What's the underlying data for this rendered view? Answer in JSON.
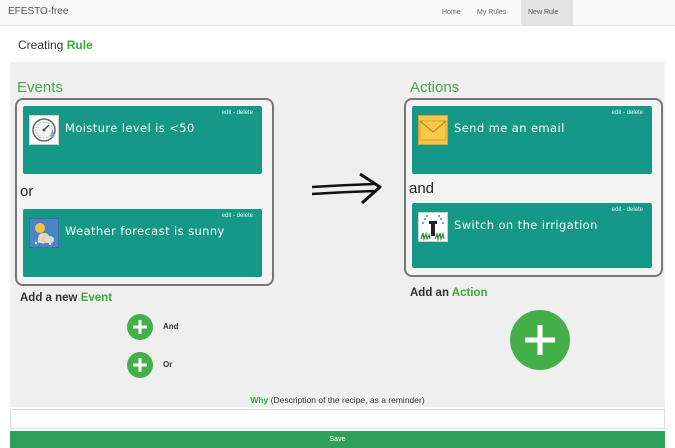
{
  "nav": {
    "brand": "EFESTO-free",
    "items": [
      {
        "label": "Home"
      },
      {
        "label": "My Rules"
      },
      {
        "label": "New Rule"
      }
    ]
  },
  "heading": {
    "prefix": "Creating",
    "highlight": "Rule"
  },
  "events": {
    "title": "Events",
    "items": [
      {
        "text": "Moisture level is <50",
        "edit_delete": "edit - delete",
        "icon": "gauge-icon"
      },
      {
        "text": "Weather forecast is sunny",
        "edit_delete": "edit - delete",
        "icon": "weather-icon"
      }
    ],
    "connector": "or"
  },
  "actions": {
    "title": "Actions",
    "items": [
      {
        "text": "Send me an email",
        "edit_delete": "edit - delete",
        "icon": "envelope-icon"
      },
      {
        "text": "Switch on the irrigation",
        "edit_delete": "edit - delete",
        "icon": "sprinkler-icon"
      }
    ],
    "connector": "and"
  },
  "add_event": {
    "prefix": "Add a new",
    "highlight": "Event",
    "and_label": "And",
    "or_label": "Or"
  },
  "add_action": {
    "prefix": "Add an",
    "highlight": "Action"
  },
  "why": {
    "highlight": "Why",
    "text": "(Description of the recipe, as a reminder)"
  },
  "description_input": {
    "value": "",
    "placeholder": ""
  },
  "save_label": "Save",
  "colors": {
    "accent": "#3aa83a",
    "card": "#169887",
    "save": "#2ea05a"
  }
}
